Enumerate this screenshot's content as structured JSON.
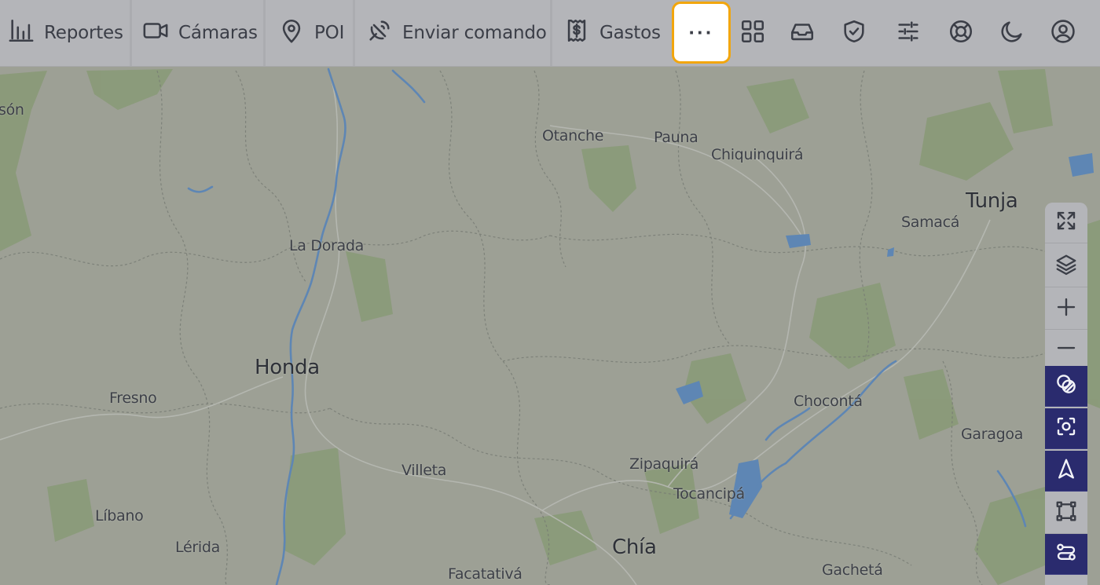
{
  "topbar": {
    "items": [
      {
        "label": "Reportes",
        "icon": "bar-chart-icon"
      },
      {
        "label": "Cámaras",
        "icon": "video-camera-icon"
      },
      {
        "label": "POI",
        "icon": "map-pin-icon"
      },
      {
        "label": "Enviar comando",
        "icon": "satellite-dish-icon"
      },
      {
        "label": "Gastos",
        "icon": "receipt-dollar-icon"
      }
    ],
    "more_label": "···",
    "icon_buttons": [
      "apps-grid-icon",
      "inbox-icon",
      "shield-check-icon",
      "sliders-icon",
      "lifebuoy-icon",
      "moon-icon",
      "user-circle-icon"
    ],
    "highlight_color": "#f2a60d"
  },
  "map": {
    "places": [
      {
        "name": "són"
      },
      {
        "name": "Otanche"
      },
      {
        "name": "Pauna"
      },
      {
        "name": "Chiquinquirá"
      },
      {
        "name": "Tunja"
      },
      {
        "name": "Samacá"
      },
      {
        "name": "La Dorada"
      },
      {
        "name": "Honda"
      },
      {
        "name": "Fresno"
      },
      {
        "name": "Chocontá"
      },
      {
        "name": "Garagoa"
      },
      {
        "name": "Villeta"
      },
      {
        "name": "Zipaquirá"
      },
      {
        "name": "Tocancipá"
      },
      {
        "name": "Líbano"
      },
      {
        "name": "Lérida"
      },
      {
        "name": "Chía"
      },
      {
        "name": "Facatativá"
      },
      {
        "name": "Gachetá"
      }
    ]
  },
  "map_tools": {
    "items": [
      {
        "icon": "fullscreen-icon",
        "active": false
      },
      {
        "icon": "layers-icon",
        "active": false
      },
      {
        "icon": "zoom-in-icon",
        "active": false
      },
      {
        "icon": "zoom-out-icon",
        "active": false
      },
      {
        "icon": "overlap-circles-icon",
        "active": true
      },
      {
        "icon": "focus-target-icon",
        "active": true
      },
      {
        "icon": "navigation-arrow-icon",
        "active": true
      },
      {
        "icon": "select-area-icon",
        "active": false
      },
      {
        "icon": "route-icon",
        "active": true
      }
    ],
    "active_color": "#2a2b6e"
  }
}
